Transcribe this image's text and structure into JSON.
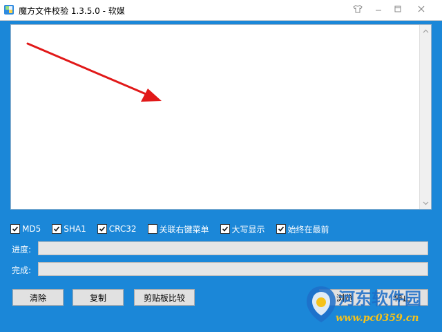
{
  "window": {
    "title": "魔方文件校验 1.3.5.0 - 软媒",
    "icons": {
      "app": "app-icon",
      "skin": "shirt-icon",
      "minimize": "minimize-icon",
      "restore": "restore-icon",
      "close": "close-icon"
    }
  },
  "output": {
    "text": ""
  },
  "options": [
    {
      "label": "MD5",
      "checked": true
    },
    {
      "label": "SHA1",
      "checked": true
    },
    {
      "label": "CRC32",
      "checked": true
    },
    {
      "label": "关联右键菜单",
      "checked": false
    },
    {
      "label": "大写显示",
      "checked": true
    },
    {
      "label": "始终在最前",
      "checked": true
    }
  ],
  "progress": {
    "label": "进度:",
    "value": 0
  },
  "complete": {
    "label": "完成:",
    "value": 0
  },
  "buttons": {
    "clear": "清除",
    "copy": "复制",
    "clipboard_compare": "剪贴板比较",
    "browse": "浏览",
    "stop": "停止"
  },
  "watermark": {
    "name": "河东软件园",
    "url": "www.pc0359.cn"
  },
  "colors": {
    "background": "#1b87d8",
    "arrow": "#e11919",
    "watermark_blue": "#1d6fc9",
    "watermark_yellow": "#f5c21b"
  }
}
